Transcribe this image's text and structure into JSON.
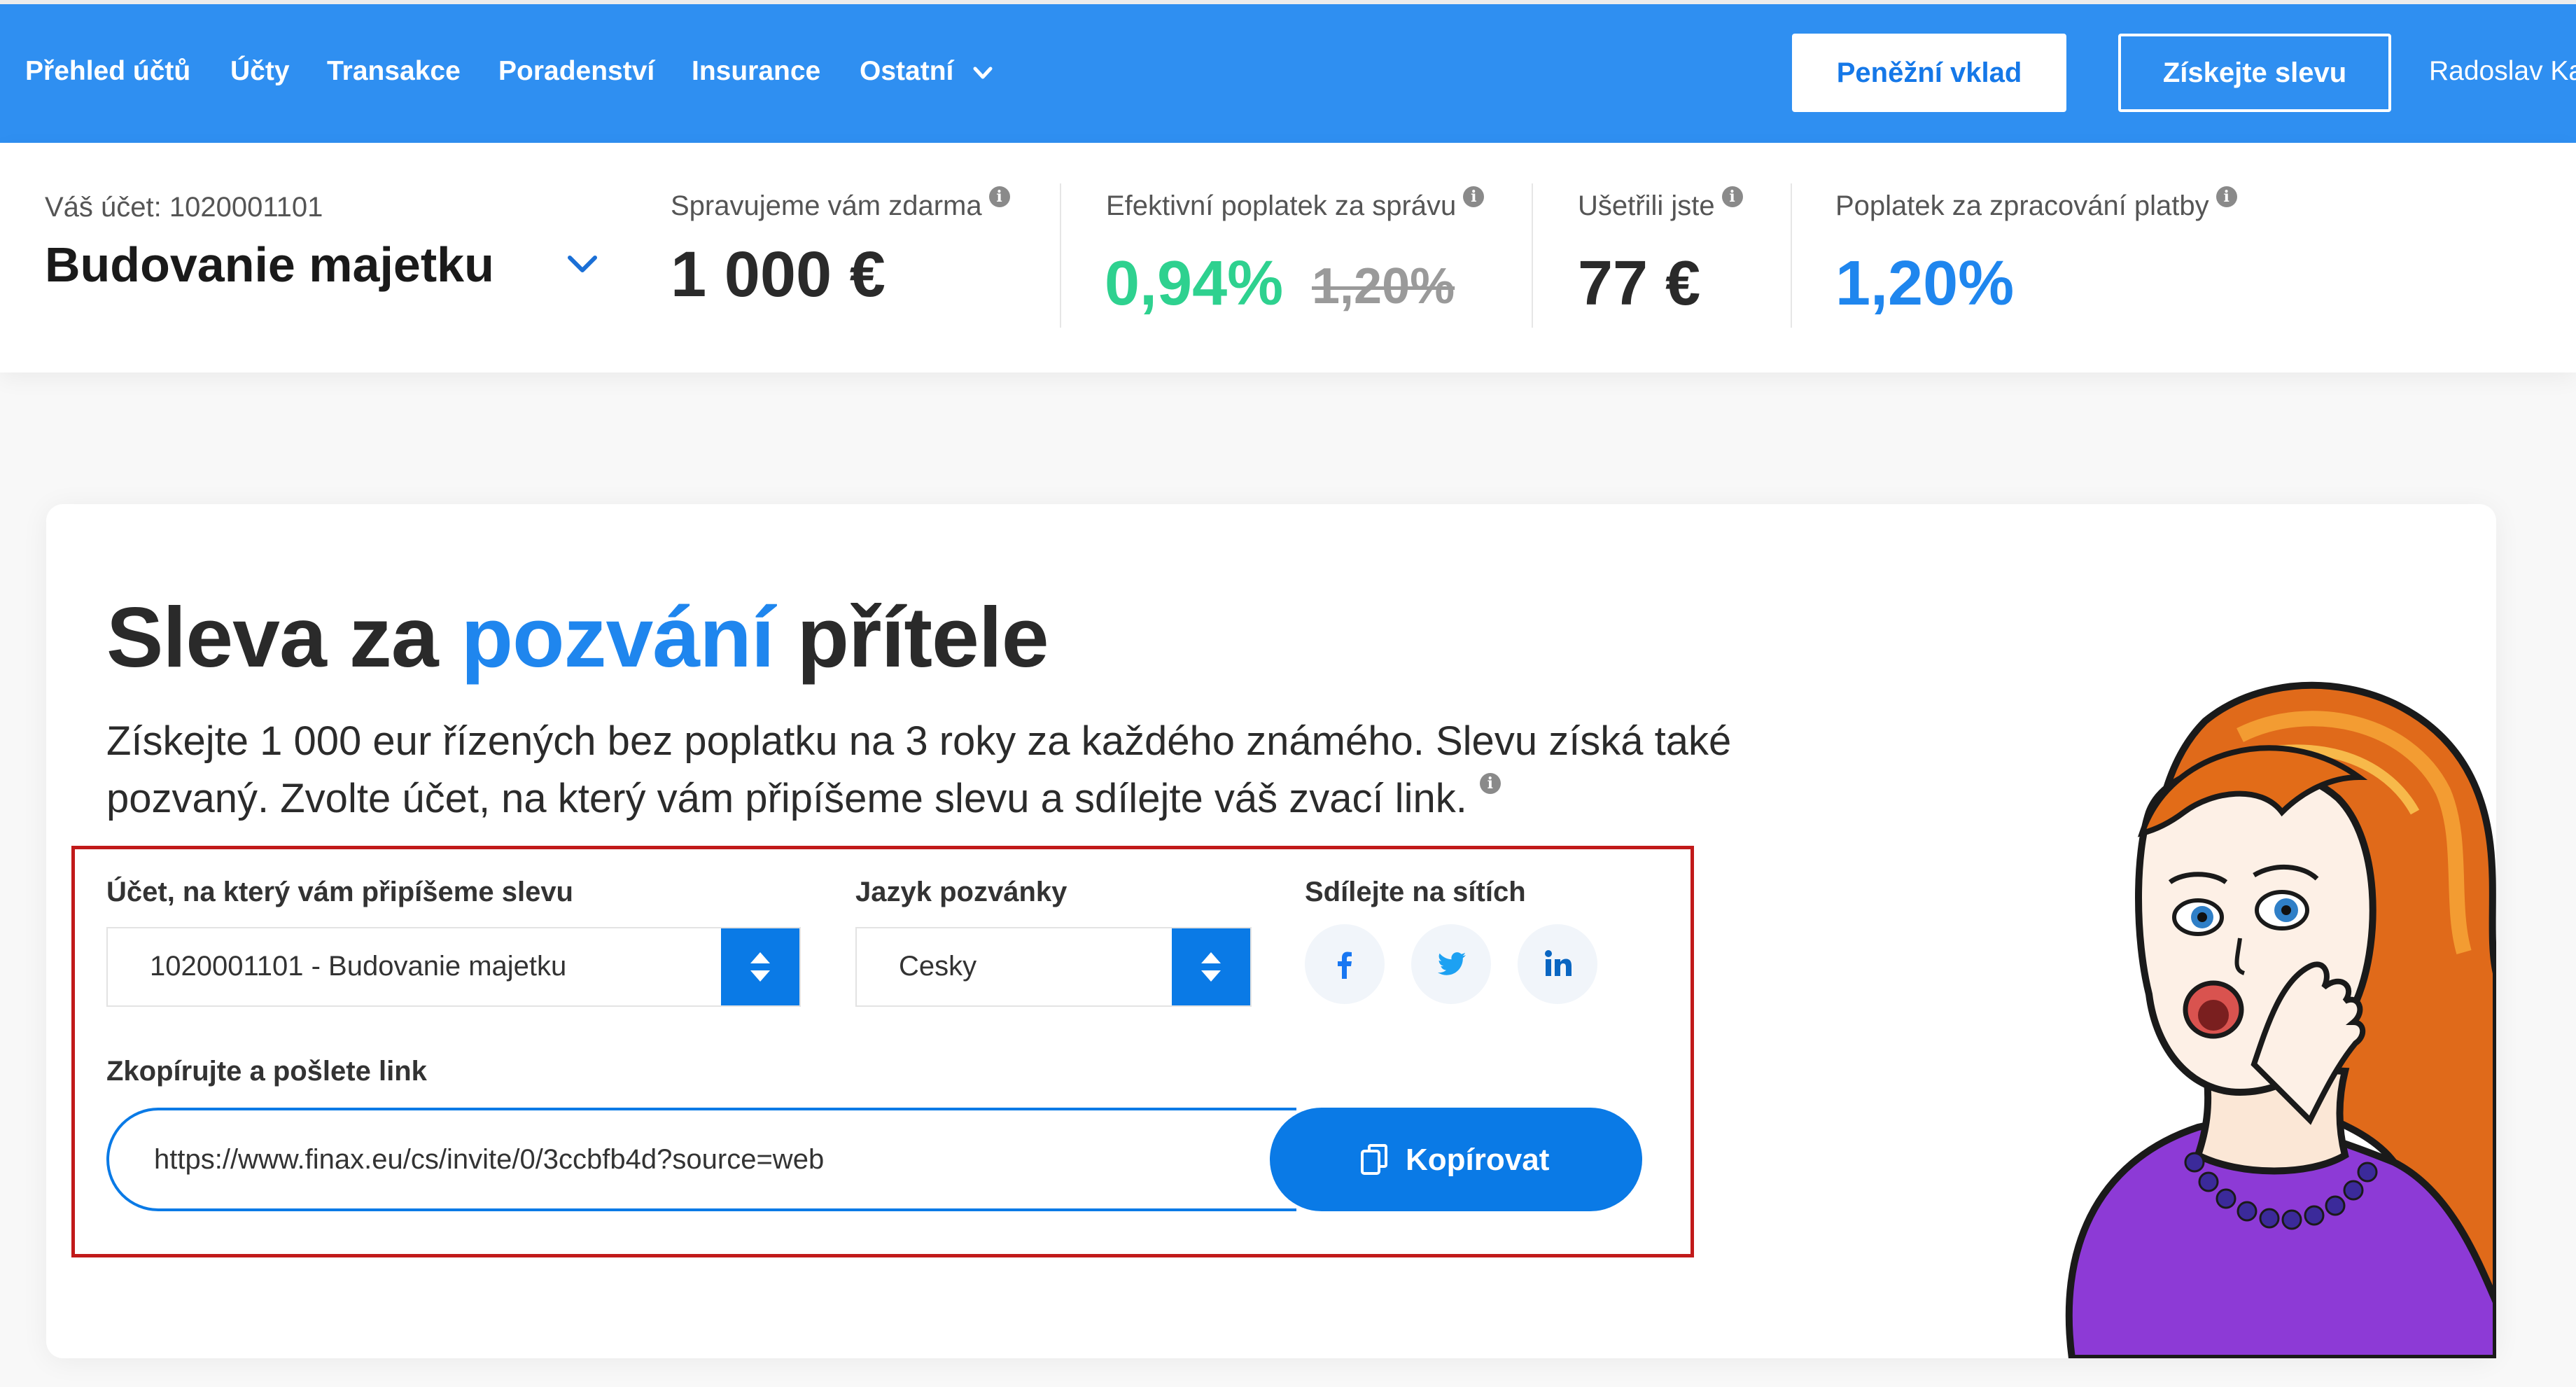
{
  "nav": {
    "items": [
      "Přehled účtů",
      "Účty",
      "Transakce",
      "Poradenství",
      "Insurance",
      "Ostatní"
    ],
    "deposit_button": "Peněžní vklad",
    "discount_button": "Získejte slevu",
    "user_name": "Radoslav Ka",
    "color": "#2f8ff1"
  },
  "account": {
    "label": "Váš účet: 1020001101",
    "name": "Budovanie majetku"
  },
  "stats": {
    "managed_free": {
      "label": "Spravujeme vám zdarma",
      "value": "1 000 €"
    },
    "effective_fee": {
      "label": "Efektivní poplatek za správu",
      "value": "0,94%",
      "old_value": "1,20%"
    },
    "saved": {
      "label": "Ušetřili jste",
      "value": "77 €"
    },
    "processing_fee": {
      "label": "Poplatek za zpracování platby",
      "value": "1,20%"
    }
  },
  "promo": {
    "title_part1": "Sleva za ",
    "title_highlight": "pozvání",
    "title_part2": " přítele",
    "description": "Získejte 1 000 eur řízených bez poplatku na 3 roky za každého známého. Slevu získá také pozvaný. Zvolte účet, na který vám připíšeme slevu a sdílejte váš zvací link."
  },
  "form": {
    "account_label": "Účet, na který vám připíšeme slevu",
    "account_value": "1020001101 - Budovanie majetku",
    "language_label": "Jazyk pozvánky",
    "language_value": "Cesky",
    "share_label": "Sdílejte na sítích",
    "social": [
      "facebook-icon",
      "twitter-icon",
      "linkedin-icon"
    ],
    "link_label": "Zkopírujte a pošlete link",
    "link_value": "https://www.finax.eu/cs/invite/0/3ccbfb4d?source=web",
    "copy_button": "Kopírovat"
  },
  "colors": {
    "accent_blue": "#0a7ae6",
    "green": "#2ed18f",
    "highlight_border": "#c11a1a"
  }
}
